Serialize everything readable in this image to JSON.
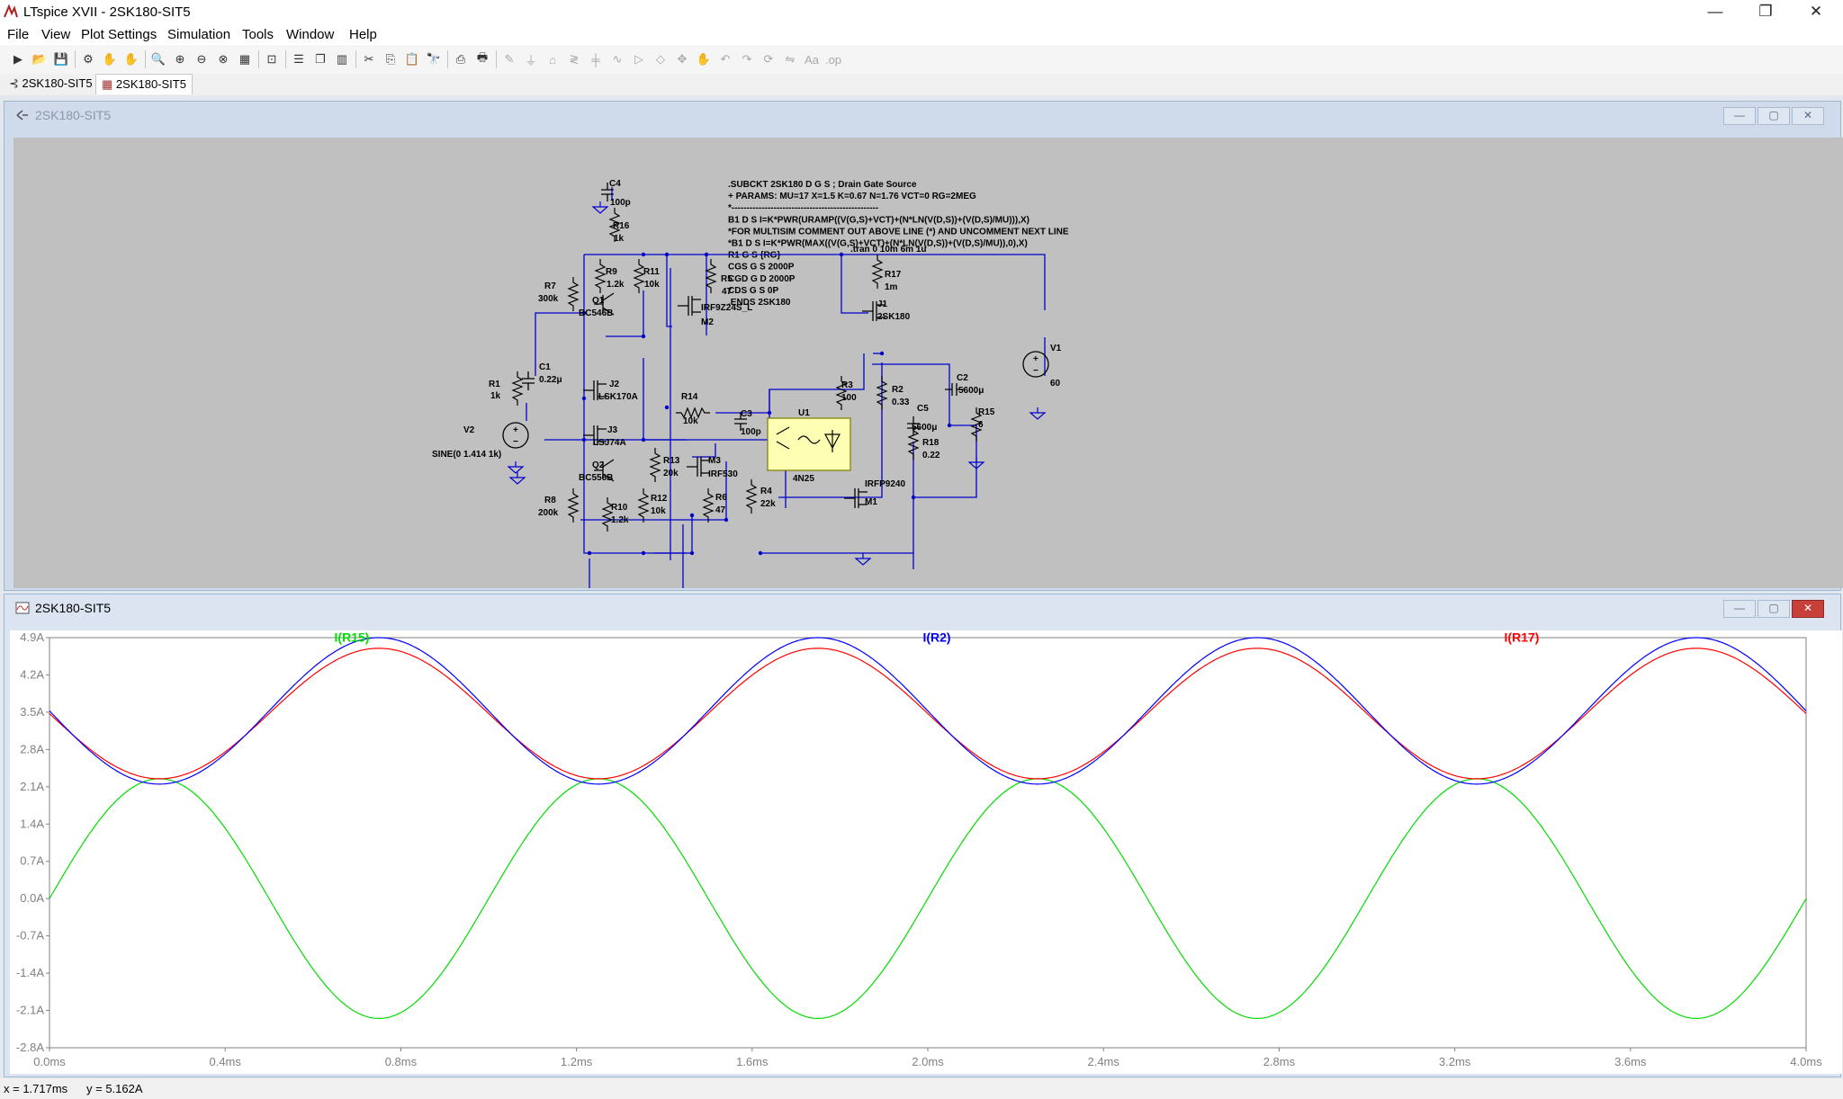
{
  "window": {
    "title": "LTspice XVII - 2SK180-SIT5",
    "controls": {
      "minimize": "—",
      "restore": "❐",
      "close": "✕"
    }
  },
  "menu": [
    "File",
    "View",
    "Plot Settings",
    "Simulation",
    "Tools",
    "Window",
    "Help"
  ],
  "toolbar": {
    "icons": [
      "run-icon",
      "open-icon",
      "save-icon",
      "control-panel-icon",
      "halt-icon",
      "pan-hand-icon",
      "zoom-in-icon",
      "zoom-area-icon",
      "zoom-out-icon",
      "zoom-full-icon",
      "autorange-icon",
      "zoom-extents-icon",
      "tile-horizontal-icon",
      "cascade-icon",
      "tile-vertical-icon",
      "cut-icon",
      "copy-icon",
      "paste-icon",
      "find-icon",
      "print-icon",
      "print-setup-icon",
      "draw-wire-icon",
      "ground-icon",
      "label-net-icon",
      "resistor-icon",
      "capacitor-icon",
      "inductor-icon",
      "diode-icon",
      "component-icon",
      "move-icon",
      "drag-icon",
      "undo-icon",
      "redo-icon",
      "rotate-icon",
      "mirror-icon",
      "text-icon",
      "spice-directive-icon"
    ]
  },
  "tabs": [
    {
      "label": "2SK180-SIT5",
      "type": "schematic"
    },
    {
      "label": "2SK180-SIT5",
      "type": "waveform"
    }
  ],
  "schematic": {
    "title": "2SK180-SIT5",
    "directive_lines": [
      ".SUBCKT 2SK180 D G S ; Drain Gate Source",
      "+ PARAMS: MU=17 X=1.5 K=0.67 N=1.76 VCT=0 RG=2MEG",
      "*-------------------------------------------------",
      "B1 D S I=K*PWR(URAMP((V(G,S)+VCT)+(N*LN(V(D,S))+(V(D,S)/MU))),X)",
      "*FOR MULTISIM COMMENT OUT ABOVE LINE (*) AND UNCOMMENT NEXT LINE",
      "*B1 D S I=K*PWR(MAX((V(G,S)+VCT)+(N*LN(V(D,S))+(V(D,S)/MU)),0),X)",
      "R1 G S {RG}",
      "CGS G S 2000P",
      "CGD G D 2000P",
      "CDS G S 0P",
      ".ENDS 2SK180"
    ],
    "tran_directive": ".tran 0 10m 6m 1u",
    "components": [
      {
        "ref": "C4",
        "value": "100p"
      },
      {
        "ref": "R16",
        "value": "1k"
      },
      {
        "ref": "R9",
        "value": "1.2k"
      },
      {
        "ref": "R11",
        "value": "10k"
      },
      {
        "ref": "R5",
        "value": "47"
      },
      {
        "ref": "R7",
        "value": "300k"
      },
      {
        "ref": "Q1",
        "value": "BC546B"
      },
      {
        "ref": "M2",
        "value": "IRF9Z24S_L"
      },
      {
        "ref": "R17",
        "value": "1m"
      },
      {
        "ref": "J1",
        "value": "2SK180"
      },
      {
        "ref": "C2",
        "value": "5600μ"
      },
      {
        "ref": "V1",
        "value": "60"
      },
      {
        "ref": "C1",
        "value": "0.22μ"
      },
      {
        "ref": "R1",
        "value": "1k"
      },
      {
        "ref": "J2",
        "value": "LSK170A"
      },
      {
        "ref": "R14",
        "value": "10k"
      },
      {
        "ref": "R3",
        "value": "100"
      },
      {
        "ref": "R2",
        "value": "0.33"
      },
      {
        "ref": "R15",
        "value": "6"
      },
      {
        "ref": "C3",
        "value": "100p"
      },
      {
        "ref": "U1",
        "value": "4N25"
      },
      {
        "ref": "C5",
        "value": "5600μ"
      },
      {
        "ref": "R18",
        "value": "0.22"
      },
      {
        "ref": "V2",
        "value": "SINE(0 1.414 1k)"
      },
      {
        "ref": "J3",
        "value": "LSJ74A"
      },
      {
        "ref": "Q2",
        "value": "BC556B"
      },
      {
        "ref": "R13",
        "value": "20k"
      },
      {
        "ref": "M3",
        "value": "IRF530"
      },
      {
        "ref": "R4",
        "value": "22k"
      },
      {
        "ref": "M1",
        "value": "IRFP9240"
      },
      {
        "ref": "R8",
        "value": "200k"
      },
      {
        "ref": "R10",
        "value": "1.2k"
      },
      {
        "ref": "R12",
        "value": "10k"
      },
      {
        "ref": "R6",
        "value": "47"
      }
    ]
  },
  "waveform": {
    "title": "2SK180-SIT5",
    "traces": [
      {
        "name": "I(R15)",
        "color": "#00dd00"
      },
      {
        "name": "I(R2)",
        "color": "#0000ff"
      },
      {
        "name": "I(R17)",
        "color": "#ff0000"
      }
    ]
  },
  "chart_data": {
    "type": "line",
    "x_unit": "ms",
    "xlim": [
      0,
      4.0
    ],
    "ylim": [
      -2.8,
      4.9
    ],
    "x_ticks": [
      "0.0ms",
      "0.4ms",
      "0.8ms",
      "1.2ms",
      "1.6ms",
      "2.0ms",
      "2.4ms",
      "2.8ms",
      "3.2ms",
      "3.6ms",
      "4.0ms"
    ],
    "y_ticks": [
      "4.9A",
      "4.2A",
      "3.5A",
      "2.8A",
      "2.1A",
      "1.4A",
      "0.7A",
      "0.0A",
      "-0.7A",
      "-1.4A",
      "-2.1A",
      "-2.8A"
    ],
    "grid": false,
    "series": [
      {
        "name": "I(R15)",
        "color": "#00dd00",
        "x": [
          0.0,
          0.25,
          0.5,
          0.75,
          1.0,
          1.25,
          1.5,
          1.75,
          2.0,
          2.25,
          2.5,
          2.75,
          3.0,
          3.25,
          3.5,
          3.75,
          4.0
        ],
        "y": [
          0.0,
          2.2,
          0.0,
          -2.3,
          0.0,
          2.2,
          0.0,
          -2.3,
          0.0,
          2.2,
          0.0,
          -2.3,
          0.0,
          2.2,
          0.0,
          -2.3,
          0.0
        ]
      },
      {
        "name": "I(R2)",
        "color": "#0000ff",
        "x": [
          0.0,
          0.25,
          0.5,
          0.75,
          1.0,
          1.25,
          1.5,
          1.75,
          2.0,
          2.25,
          2.5,
          2.75,
          3.0,
          3.25,
          3.5,
          3.75,
          4.0
        ],
        "y": [
          3.5,
          2.15,
          3.5,
          4.9,
          3.5,
          2.15,
          3.5,
          4.9,
          3.5,
          2.15,
          3.5,
          4.9,
          3.5,
          2.15,
          3.5,
          4.9,
          3.5
        ]
      },
      {
        "name": "I(R17)",
        "color": "#ff0000",
        "x": [
          0.0,
          0.25,
          0.5,
          0.75,
          1.0,
          1.25,
          1.5,
          1.75,
          2.0,
          2.25,
          2.5,
          2.75,
          3.0,
          3.25,
          3.5,
          3.75,
          4.0
        ],
        "y": [
          3.45,
          2.25,
          3.45,
          4.7,
          3.45,
          2.25,
          3.45,
          4.7,
          3.45,
          2.25,
          3.45,
          4.7,
          3.45,
          2.25,
          3.45,
          4.7,
          3.45
        ]
      }
    ]
  },
  "status": {
    "x_readout": "x = 1.717ms",
    "y_readout": "y = 5.162A"
  }
}
